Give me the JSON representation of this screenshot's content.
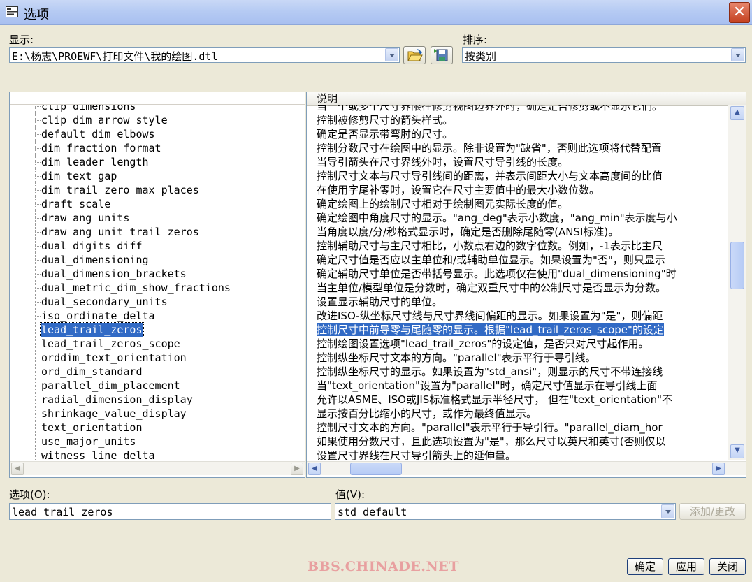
{
  "window": {
    "title": "选项",
    "close_glyph": "✕"
  },
  "display": {
    "label": "显示:",
    "path": "E:\\杨志\\PROEWF\\打印文件\\我的绘图.dtl"
  },
  "sort": {
    "label": "排序:",
    "value": "按类别"
  },
  "list": {
    "header": "说明",
    "items": [
      {
        "name": "clip_dimensions",
        "desc": "当一个或多个尺寸界限在修剪视图边界外时，确定是否修剪或不显示它们。"
      },
      {
        "name": "clip_dim_arrow_style",
        "desc": "控制被修剪尺寸的箭头样式。"
      },
      {
        "name": "default_dim_elbows",
        "desc": "确定是否显示带弯肘的尺寸。"
      },
      {
        "name": "dim_fraction_format",
        "desc": "控制分数尺寸在绘图中的显示。除非设置为\"缺省\"，否则此选项将代替配置"
      },
      {
        "name": "dim_leader_length",
        "desc": "当导引箭头在尺寸界线外时，设置尺寸导引线的长度。"
      },
      {
        "name": "dim_text_gap",
        "desc": "控制尺寸文本与尺寸导引线间的距离，并表示间距大小与文本高度间的比值"
      },
      {
        "name": "dim_trail_zero_max_places",
        "desc": "在使用字尾补零时，设置它在尺寸主要值中的最大小数位数。"
      },
      {
        "name": "draft_scale",
        "desc": "确定绘图上的绘制尺寸相对于绘制图元实际长度的值。"
      },
      {
        "name": "draw_ang_units",
        "desc": "确定绘图中角度尺寸的显示。\"ang_deg\"表示小数度，\"ang_min\"表示度与小"
      },
      {
        "name": "draw_ang_unit_trail_zeros",
        "desc": "当角度以度/分/秒格式显示时，确定是否删除尾随零(ANSI标准)。"
      },
      {
        "name": "dual_digits_diff",
        "desc": "控制辅助尺寸与主尺寸相比，小数点右边的数字位数。例如，-1表示比主尺"
      },
      {
        "name": "dual_dimensioning",
        "desc": "确定尺寸值是否应以主单位和/或辅助单位显示。如果设置为\"否\"，则只显示"
      },
      {
        "name": "dual_dimension_brackets",
        "desc": "确定辅助尺寸单位是否带括号显示。此选项仅在使用\"dual_dimensioning\"时"
      },
      {
        "name": "dual_metric_dim_show_fractions",
        "desc": "当主单位/模型单位是分数时，确定双重尺寸中的公制尺寸是否显示为分数。"
      },
      {
        "name": "dual_secondary_units",
        "desc": "设置显示辅助尺寸的单位。"
      },
      {
        "name": "iso_ordinate_delta",
        "desc": "改进ISO-纵坐标尺寸线与尺寸界线间偏距的显示。如果设置为\"是\"，则偏距"
      },
      {
        "name": "lead_trail_zeros",
        "desc": "控制尺寸中前导零与尾随零的显示。根据\"lead_trail_zeros_scope\"的设定"
      },
      {
        "name": "lead_trail_zeros_scope",
        "desc": "控制绘图设置选项\"lead_trail_zeros\"的设定值，是否只对尺寸起作用。"
      },
      {
        "name": "orddim_text_orientation",
        "desc": "控制纵坐标尺寸文本的方向。\"parallel\"表示平行于导引线。"
      },
      {
        "name": "ord_dim_standard",
        "desc": "控制纵坐标尺寸的显示。如果设置为\"std_ansi\"，则显示的尺寸不带连接线"
      },
      {
        "name": "parallel_dim_placement",
        "desc": "当\"text_orientation\"设置为\"parallel\"时，确定尺寸值显示在导引线上面"
      },
      {
        "name": "radial_dimension_display",
        "desc": "允许以ASME、ISO或JIS标准格式显示半径尺寸，  但在\"text_orientation\"不"
      },
      {
        "name": "shrinkage_value_display",
        "desc": "显示按百分比缩小的尺寸，或作为最终值显示。"
      },
      {
        "name": "text_orientation",
        "desc": "控制尺寸文本的方向。\"parallel\"表示平行于导引行。\"parallel_diam_hor"
      },
      {
        "name": "use_major_units",
        "desc": "如果使用分数尺寸，且此选项设置为\"是\"，那么尺寸以英尺和英寸(否则仅以"
      },
      {
        "name": "witness_line_delta",
        "desc": "设置尺寸界线在尺寸导引箭头上的延伸量。"
      }
    ],
    "selected_index": 16
  },
  "option": {
    "label": "选项(O):",
    "value": "lead_trail_zeros"
  },
  "value": {
    "label": "值(V):",
    "value": "std_default"
  },
  "buttons": {
    "add_change": "添加/更改",
    "ok": "确定",
    "apply": "应用",
    "close": "关闭"
  },
  "watermark": "BBS.CHINADE.NET",
  "colors": {
    "selection": "#316ac5",
    "watermark": "#e8a0a0"
  }
}
